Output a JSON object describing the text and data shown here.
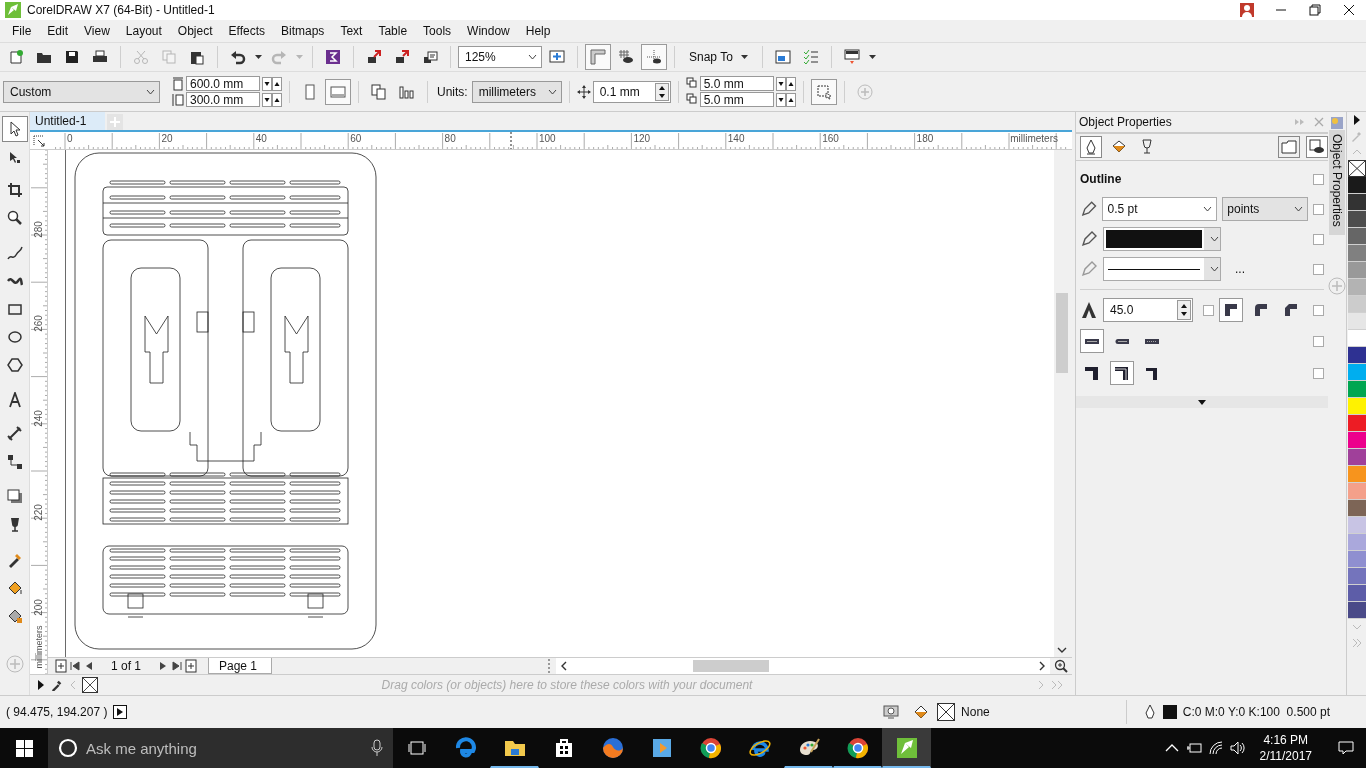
{
  "window": {
    "title": "CorelDRAW X7 (64-Bit) - Untitled-1"
  },
  "menu": [
    "File",
    "Edit",
    "View",
    "Layout",
    "Object",
    "Effects",
    "Bitmaps",
    "Text",
    "Table",
    "Tools",
    "Window",
    "Help"
  ],
  "standard_toolbar": {
    "buttons": [
      {
        "disabled": false,
        "pressed": false
      },
      {
        "disabled": false,
        "pressed": false
      },
      {
        "disabled": false,
        "pressed": false
      },
      {
        "disabled": false,
        "pressed": false
      },
      {
        "disabled": true,
        "pressed": false
      },
      {
        "disabled": true,
        "pressed": false
      },
      {
        "disabled": false,
        "pressed": false
      },
      {
        "disabled": false,
        "pressed": false
      },
      {
        "disabled": true,
        "pressed": false
      },
      {
        "disabled": false,
        "pressed": false
      },
      {
        "disabled": false,
        "pressed": false
      },
      {
        "disabled": false,
        "pressed": false
      },
      {
        "disabled": false,
        "pressed": false
      },
      {
        "disabled": false,
        "pressed": false
      },
      {
        "disabled": false,
        "pressed": true
      },
      {
        "disabled": false,
        "pressed": false
      },
      {
        "disabled": false,
        "pressed": true
      },
      {
        "disabled": false,
        "pressed": false
      },
      {
        "disabled": false,
        "pressed": false
      },
      {
        "disabled": false,
        "pressed": false
      }
    ],
    "zoom": "125%",
    "snap": "Snap To"
  },
  "property_bar": {
    "preset": "Custom",
    "width": "600.0 mm",
    "height": "300.0 mm",
    "orientations": [
      {
        "selected": false
      },
      {
        "selected": true
      }
    ],
    "units_label": "Units:",
    "units": "millimeters",
    "nudge": "0.1 mm",
    "duplicate_x": "5.0 mm",
    "duplicate_y": "5.0 mm"
  },
  "toolbox": {
    "tools": [
      {
        "selected": true
      },
      {
        "selected": false
      },
      {
        "selected": false
      },
      {
        "selected": false
      },
      {
        "selected": false
      },
      {
        "selected": false
      },
      {
        "selected": false
      },
      {
        "selected": false
      },
      {
        "selected": false
      },
      {
        "selected": false
      },
      {
        "selected": false
      },
      {
        "selected": false
      },
      {
        "selected": false
      },
      {
        "selected": false
      },
      {
        "selected": false
      },
      {
        "selected": false
      },
      {
        "selected": false
      }
    ]
  },
  "document_tabs": [
    {
      "label": "Untitled-1",
      "selected": true
    }
  ],
  "rulers": {
    "horizontal": {
      "labels": [
        "0",
        "20",
        "40",
        "60",
        "80",
        "100",
        "120",
        "140",
        "160",
        "180"
      ],
      "unit": "millimeters"
    },
    "vertical": {
      "labels": [
        "280",
        "260",
        "240",
        "220",
        "200"
      ],
      "unit": "millimeters"
    }
  },
  "page_nav": {
    "counter": "1 of 1",
    "tabs": [
      {
        "label": "Page 1",
        "selected": true
      }
    ]
  },
  "document_palette": {
    "hint": "Drag colors (or objects) here to store these colors with your document"
  },
  "docker": {
    "title": "Object Properties",
    "tabs": [
      {
        "selected": true
      },
      {
        "selected": false
      },
      {
        "selected": false
      }
    ],
    "view_buttons": [
      {
        "pressed": false
      },
      {
        "pressed": true
      }
    ],
    "section_title": "Outline",
    "section_locked": false,
    "width": {
      "value": "0.5 pt",
      "units": "points",
      "locked": false
    },
    "color": {
      "color": "#111111",
      "locked": false
    },
    "style": {
      "more": "...",
      "locked": false
    },
    "miter": {
      "value": "45.0",
      "locked": false
    },
    "joins": {
      "options": [
        {
          "selected": true
        },
        {
          "selected": false
        },
        {
          "selected": false
        }
      ],
      "locked": false
    },
    "caps": {
      "options": [
        {
          "selected": true
        },
        {
          "selected": false
        },
        {
          "selected": false
        }
      ],
      "locked": false
    },
    "positions": {
      "options": [
        {
          "selected": false
        },
        {
          "selected": true
        },
        {
          "selected": false
        }
      ],
      "locked": false
    }
  },
  "side_tab": {
    "label": "Object Properties"
  },
  "color_palette": {
    "swatches": [
      {
        "color": "#1a1a1a"
      },
      {
        "color": "#333333"
      },
      {
        "color": "#4d4d4d"
      },
      {
        "color": "#666666"
      },
      {
        "color": "#808080"
      },
      {
        "color": "#999999"
      },
      {
        "color": "#b3b3b3"
      },
      {
        "color": "#cccccc"
      },
      {
        "color": "#e6e6e6"
      },
      {
        "color": "#ffffff"
      },
      {
        "color": "#2e3192"
      },
      {
        "color": "#00aeef"
      },
      {
        "color": "#00a651"
      },
      {
        "color": "#fff200"
      },
      {
        "color": "#ed1c24"
      },
      {
        "color": "#ec008c"
      },
      {
        "color": "#a0409a"
      },
      {
        "color": "#f7941d"
      },
      {
        "color": "#f4a08a"
      },
      {
        "color": "#7d6556"
      },
      {
        "color": "#c8c4e4"
      },
      {
        "color": "#aaa8dc"
      },
      {
        "color": "#8f8fd0"
      },
      {
        "color": "#7474bc"
      },
      {
        "color": "#5d5da8"
      },
      {
        "color": "#4a4a88"
      }
    ]
  },
  "status_bar": {
    "coordinates": "( 94.475, 194.207 )",
    "fill": "None",
    "outline": "C:0 M:0 Y:0 K:100  0.500 pt",
    "outline_swatch": {
      "color": "#111111"
    }
  },
  "taskbar": {
    "search": {
      "placeholder": "Ask me anything"
    },
    "apps": [
      {
        "running": false,
        "active": false
      },
      {
        "running": true,
        "active": false
      },
      {
        "running": false,
        "active": false
      },
      {
        "running": false,
        "active": false
      },
      {
        "running": false,
        "active": false
      },
      {
        "running": false,
        "active": false
      },
      {
        "running": false,
        "active": false
      },
      {
        "running": true,
        "active": false
      },
      {
        "running": true,
        "active": false
      },
      {
        "running": true,
        "active": true
      }
    ],
    "time": "4:16 PM",
    "date": "2/11/2017"
  }
}
